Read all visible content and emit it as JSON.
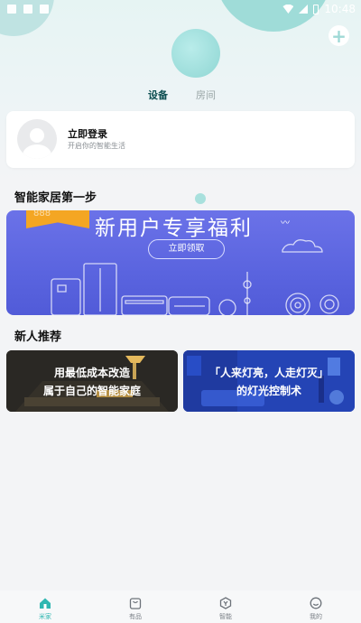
{
  "status_bar": {
    "time": "10:48"
  },
  "header": {
    "tabs": [
      {
        "label": "设备",
        "active": true
      },
      {
        "label": "房间",
        "active": false
      }
    ]
  },
  "login_card": {
    "title": "立即登录",
    "subtitle": "开启你的智能生活"
  },
  "sections": {
    "first_steps_title": "智能家居第一步",
    "newbie_title": "新人推荐"
  },
  "promo_banner": {
    "title": "新用户专享福利",
    "button_label": "立即领取"
  },
  "recommend_cards": [
    {
      "line1": "用最低成本改造",
      "line2": "属于自己的智能家庭"
    },
    {
      "line1": "「人来灯亮，人走灯灭」",
      "line2": "的灯光控制术"
    }
  ],
  "bottom_nav": [
    {
      "label": "米家",
      "icon": "home-icon",
      "active": true
    },
    {
      "label": "有品",
      "icon": "shop-bag-icon",
      "active": false
    },
    {
      "label": "智能",
      "icon": "smart-icon",
      "active": false
    },
    {
      "label": "我的",
      "icon": "profile-icon",
      "active": false
    }
  ],
  "colors": {
    "accent": "#2fb7b1",
    "banner": "#5a64df",
    "promo_tag": "#f4a623"
  }
}
